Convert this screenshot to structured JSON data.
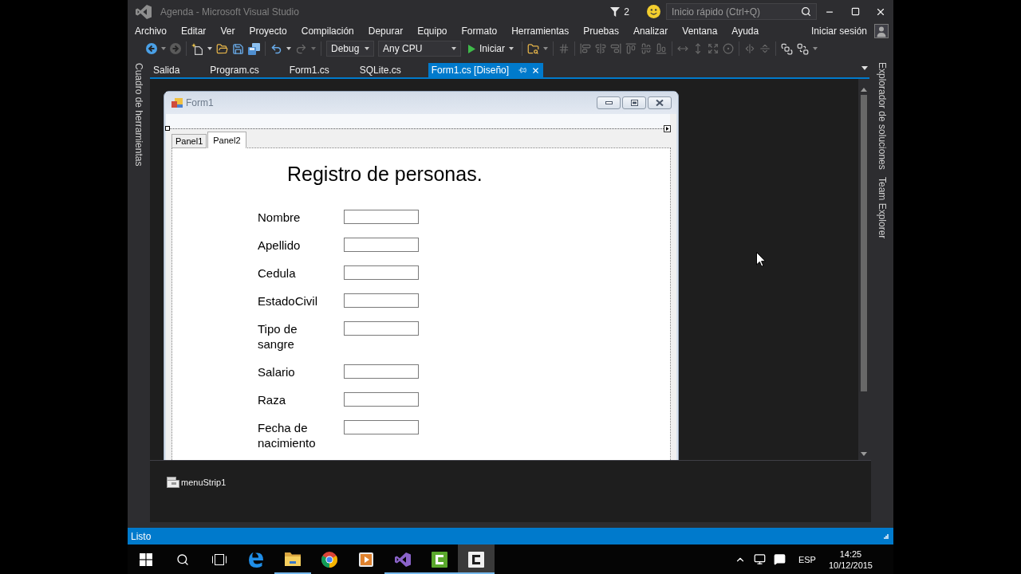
{
  "title_bar": {
    "title": "Agenda - Microsoft Visual Studio",
    "notification_count": "2",
    "quick_launch": {
      "placeholder": "Inicio rápido (Ctrl+Q)"
    }
  },
  "menu_bar": {
    "items": [
      "Archivo",
      "Editar",
      "Ver",
      "Proyecto",
      "Compilación",
      "Depurar",
      "Equipo",
      "Formato",
      "Herramientas",
      "Pruebas",
      "Analizar",
      "Ventana",
      "Ayuda"
    ],
    "sign_in": "Iniciar sesión"
  },
  "toolbar": {
    "configuration": "Debug",
    "platform": "Any CPU",
    "start": "Iniciar"
  },
  "left_dock": {
    "tabs": [
      "Cuadro de herramientas"
    ]
  },
  "document_tabs": [
    {
      "label": "Salida",
      "selected": false
    },
    {
      "label": "Program.cs",
      "selected": false
    },
    {
      "label": "Form1.cs",
      "selected": false
    },
    {
      "label": "SQLite.cs",
      "selected": false
    },
    {
      "label": "Form1.cs [Diseño]",
      "selected": true
    }
  ],
  "right_dock": {
    "tabs": [
      "Explorador de soluciones",
      "Team Explorer"
    ]
  },
  "form": {
    "title": "Form1",
    "tabs": [
      {
        "label": "Panel1",
        "selected": false
      },
      {
        "label": "Panel2",
        "selected": true
      }
    ],
    "heading": "Registro de personas.",
    "fields": [
      {
        "label": "Nombre"
      },
      {
        "label": "Apellido"
      },
      {
        "label": "Cedula"
      },
      {
        "label": "EstadoCivil"
      },
      {
        "label": "Tipo de sangre"
      },
      {
        "label": "Salario"
      },
      {
        "label": "Raza"
      },
      {
        "label": "Fecha de nacimiento"
      }
    ]
  },
  "component_tray": {
    "items": [
      "menuStrip1"
    ]
  },
  "status_bar": {
    "text": "Listo"
  },
  "taskbar": {
    "apps": [
      {
        "kind": "browser",
        "running": false,
        "selected": false
      },
      {
        "kind": "folder",
        "running": true,
        "selected": false
      },
      {
        "kind": "web",
        "running": false,
        "selected": false
      },
      {
        "kind": "player",
        "running": false,
        "selected": false
      },
      {
        "kind": "ide",
        "running": true,
        "selected": false
      },
      {
        "kind": "recorder",
        "running": true,
        "selected": false
      },
      {
        "kind": "editor",
        "running": true,
        "selected": true
      }
    ],
    "language": "ESP",
    "time": "14:25",
    "date": "10/12/2015"
  }
}
